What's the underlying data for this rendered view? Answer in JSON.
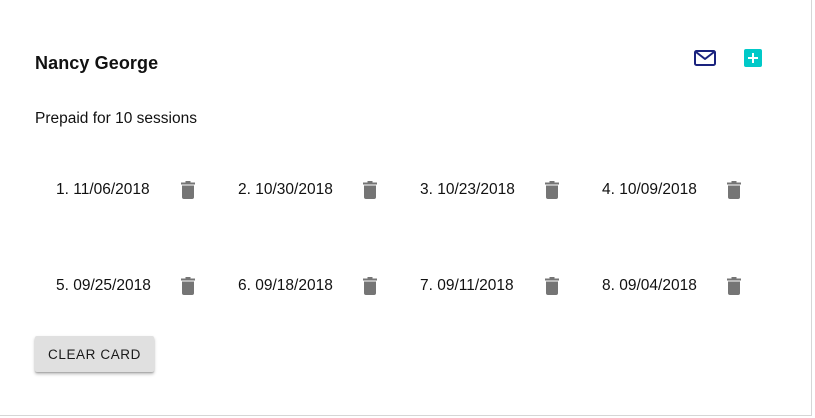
{
  "client": {
    "name": "Nancy George",
    "prepaid_text": "Prepaid for 10 sessions"
  },
  "actions": {
    "mail_icon": "mail-icon",
    "add_icon": "plus-box-icon",
    "mail_color": "#1a237e",
    "add_color": "#00c9c8"
  },
  "sessions": [
    {
      "label": "1. 11/06/2018"
    },
    {
      "label": "2. 10/30/2018"
    },
    {
      "label": "3. 10/23/2018"
    },
    {
      "label": "4. 10/09/2018"
    },
    {
      "label": "5. 09/25/2018"
    },
    {
      "label": "6. 09/18/2018"
    },
    {
      "label": "7. 09/11/2018"
    },
    {
      "label": "8. 09/04/2018"
    }
  ],
  "trash_icon": "trash-icon",
  "trash_color": "#757575",
  "clear_button": {
    "label": "CLEAR CARD"
  }
}
